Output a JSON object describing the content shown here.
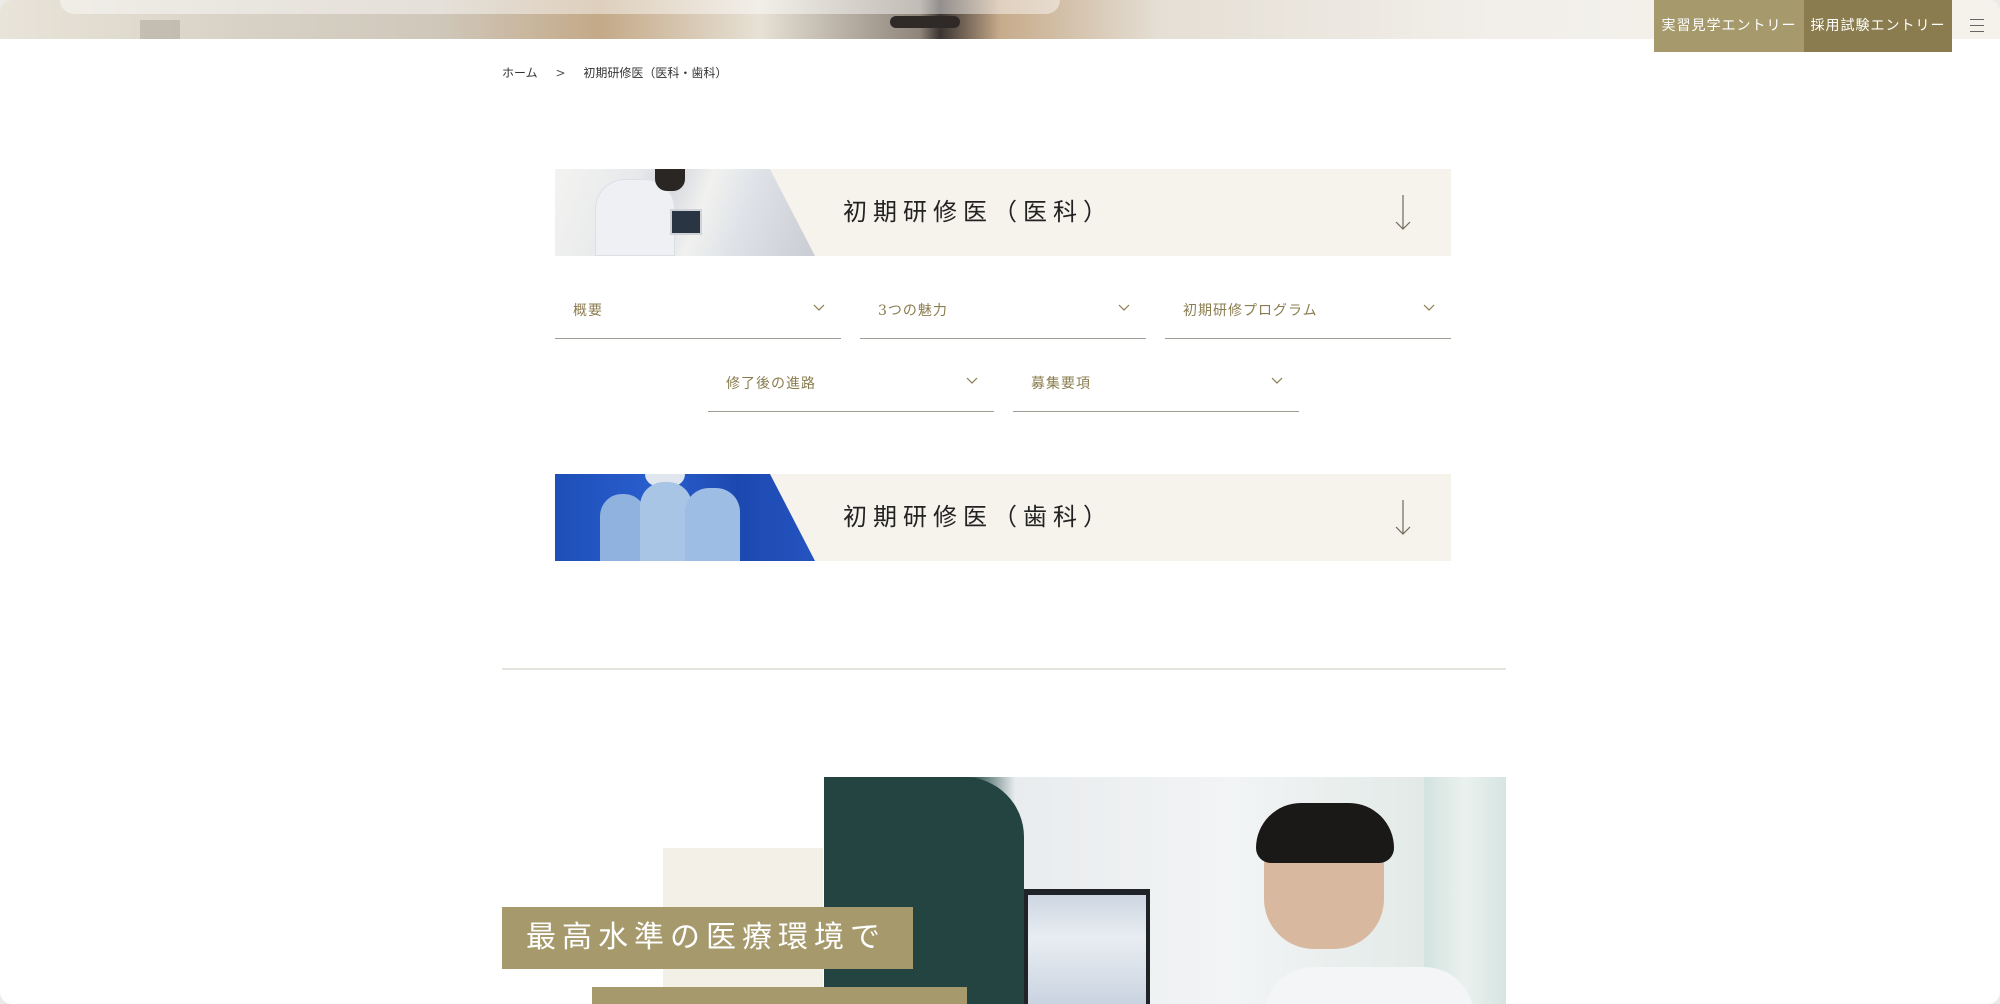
{
  "header": {
    "visit_entry_label": "実習見学エントリー",
    "exam_entry_label": "採用試験エントリー",
    "menu_icon": "hamburger-menu-icon"
  },
  "breadcrumb": {
    "home": "ホーム",
    "separator": ">",
    "current": "初期研修医（医科・歯科）"
  },
  "sections": [
    {
      "title": "初期研修医（医科）",
      "arrow_icon": "arrow-down-icon",
      "dropdowns": [
        {
          "label": "概要"
        },
        {
          "label": "3つの魅力"
        },
        {
          "label": "初期研修プログラム"
        },
        {
          "label": "修了後の進路"
        },
        {
          "label": "募集要項"
        }
      ]
    },
    {
      "title": "初期研修医（歯科）",
      "arrow_icon": "arrow-down-icon"
    }
  ],
  "feature": {
    "catch_line_1": "最高水準の医療環境で"
  },
  "colors": {
    "accent_gold": "#a69a6c",
    "accent_dark_gold": "#8a7c4e",
    "banner_bg": "#f6f3ec"
  }
}
